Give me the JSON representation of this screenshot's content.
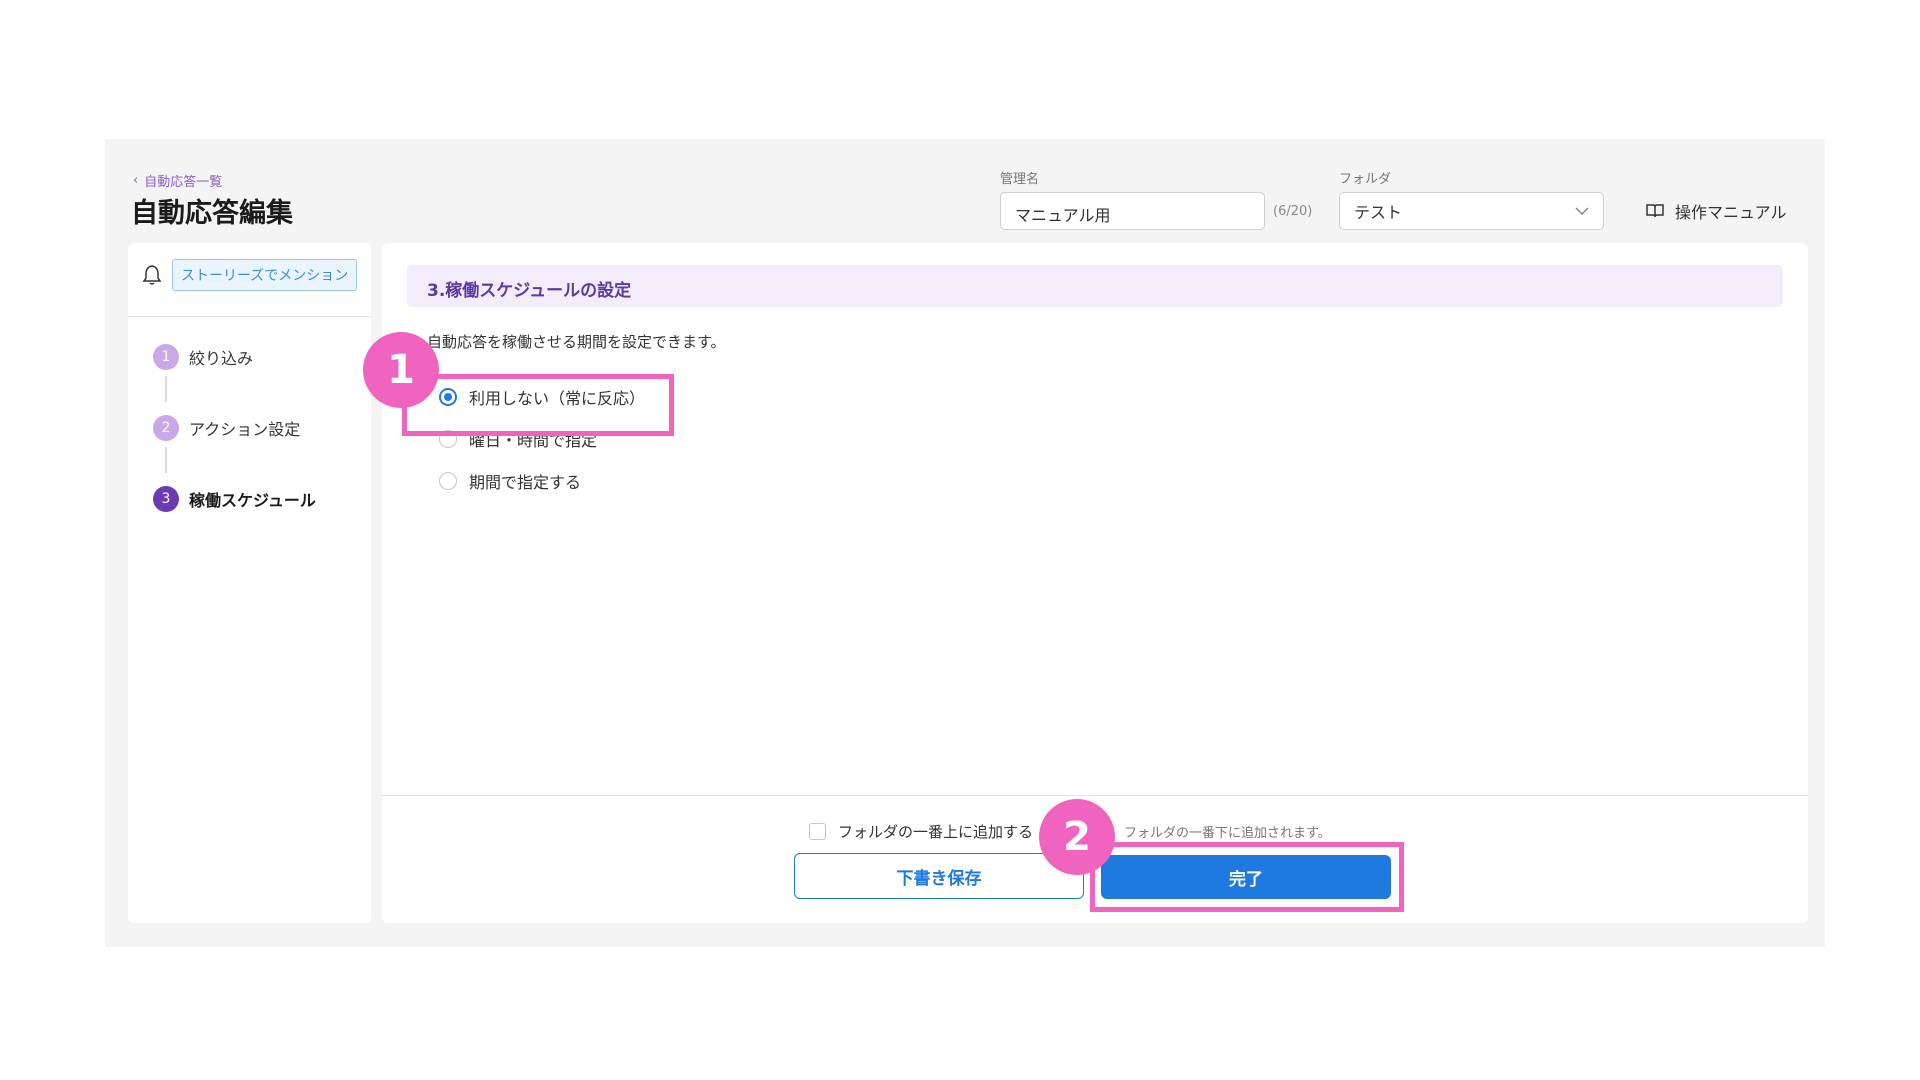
{
  "header": {
    "back_label": "自動応答一覧",
    "title": "自動応答編集",
    "admin_name_label": "管理名",
    "admin_name_value": "マニュアル用",
    "admin_name_counter": "(6/20)",
    "folder_label": "フォルダ",
    "folder_value": "テスト",
    "manual_label": "操作マニュアル"
  },
  "sidebar": {
    "tag": "ストーリーズでメンション",
    "steps": [
      {
        "num": "1",
        "label": "絞り込み"
      },
      {
        "num": "2",
        "label": "アクション設定"
      },
      {
        "num": "3",
        "label": "稼働スケジュール"
      }
    ],
    "active_step": 3
  },
  "main": {
    "section_title": "3.稼働スケジュールの設定",
    "description": "自動応答を稼働させる期間を設定できます。",
    "options": [
      {
        "label": "利用しない（常に反応）",
        "checked": true
      },
      {
        "label": "曜日・時間で指定",
        "checked": false
      },
      {
        "label": "期間で指定する",
        "checked": false
      }
    ]
  },
  "footer": {
    "checkbox_label": "フォルダの一番上に追加する",
    "checkbox_hint": "場合、フォルダの一番下に追加されます。",
    "draft_button": "下書き保存",
    "done_button": "完了"
  },
  "annotations": {
    "badge_1": "1",
    "badge_2": "2",
    "highlight_color": "#f064c0"
  },
  "colors": {
    "accent_blue": "#1f7ae0",
    "accent_purple": "#6b3bb4",
    "section_bg": "#f3ecfb"
  },
  "icons": [
    "chevron-left-icon",
    "chevron-down-icon",
    "book-icon",
    "bell-icon"
  ]
}
